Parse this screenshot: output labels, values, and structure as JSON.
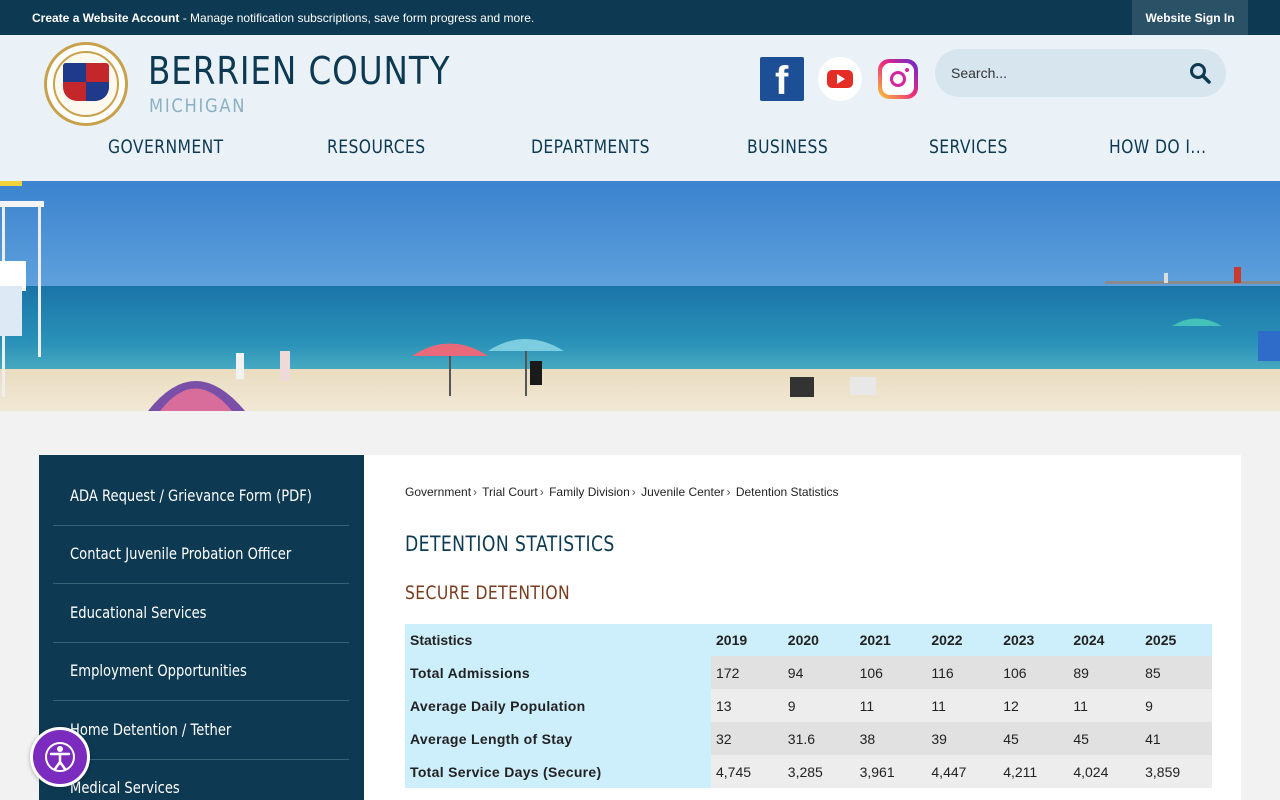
{
  "topbar": {
    "create_link": "Create a Website Account",
    "create_desc": " - Manage notification subscriptions, save form progress and more.",
    "sign_in": "Website Sign In"
  },
  "header": {
    "title": "BERRIEN COUNTY",
    "subtitle": "MICHIGAN",
    "search_placeholder": "Search...",
    "social": [
      "facebook-icon",
      "youtube-icon",
      "instagram-icon"
    ]
  },
  "nav": {
    "items": [
      "GOVERNMENT",
      "RESOURCES",
      "DEPARTMENTS",
      "BUSINESS",
      "SERVICES",
      "HOW DO I..."
    ]
  },
  "sidebar": {
    "items": [
      "ADA Request / Grievance Form (PDF)",
      "Contact Juvenile Probation Officer",
      "Educational Services",
      "Employment Opportunities",
      "Home Detention / Tether",
      "Medical Services"
    ]
  },
  "breadcrumb": [
    "Government",
    "Trial Court",
    "Family Division",
    "Juvenile Center",
    "Detention Statistics"
  ],
  "page_title": "DETENTION STATISTICS",
  "section_title": "SECURE DETENTION",
  "table": {
    "headers": [
      "Statistics",
      "2019",
      "2020",
      "2021",
      "2022",
      "2023",
      "2024",
      "2025"
    ],
    "rows": [
      {
        "label": "Total Admissions",
        "values": [
          "172",
          "94",
          "106",
          "116",
          "106",
          "89",
          "85"
        ]
      },
      {
        "label": "Average Daily Population",
        "values": [
          "13",
          "9",
          "11",
          "11",
          "12",
          "11",
          "9"
        ]
      },
      {
        "label": "Average Length of Stay",
        "values": [
          "32",
          "31.6",
          "38",
          "39",
          "45",
          "45",
          "41"
        ]
      },
      {
        "label": "Total Service Days (Secure)",
        "values": [
          "4,745",
          "3,285",
          "3,961",
          "4,447",
          "4,211",
          "4,024",
          "3,859"
        ]
      }
    ]
  },
  "colors": {
    "brand_dark": "#0d3a52",
    "header_bg": "#eaf2f8",
    "table_header": "#cdeefb",
    "section_heading": "#7a3b1e",
    "accessibility": "#7b2cbf"
  }
}
